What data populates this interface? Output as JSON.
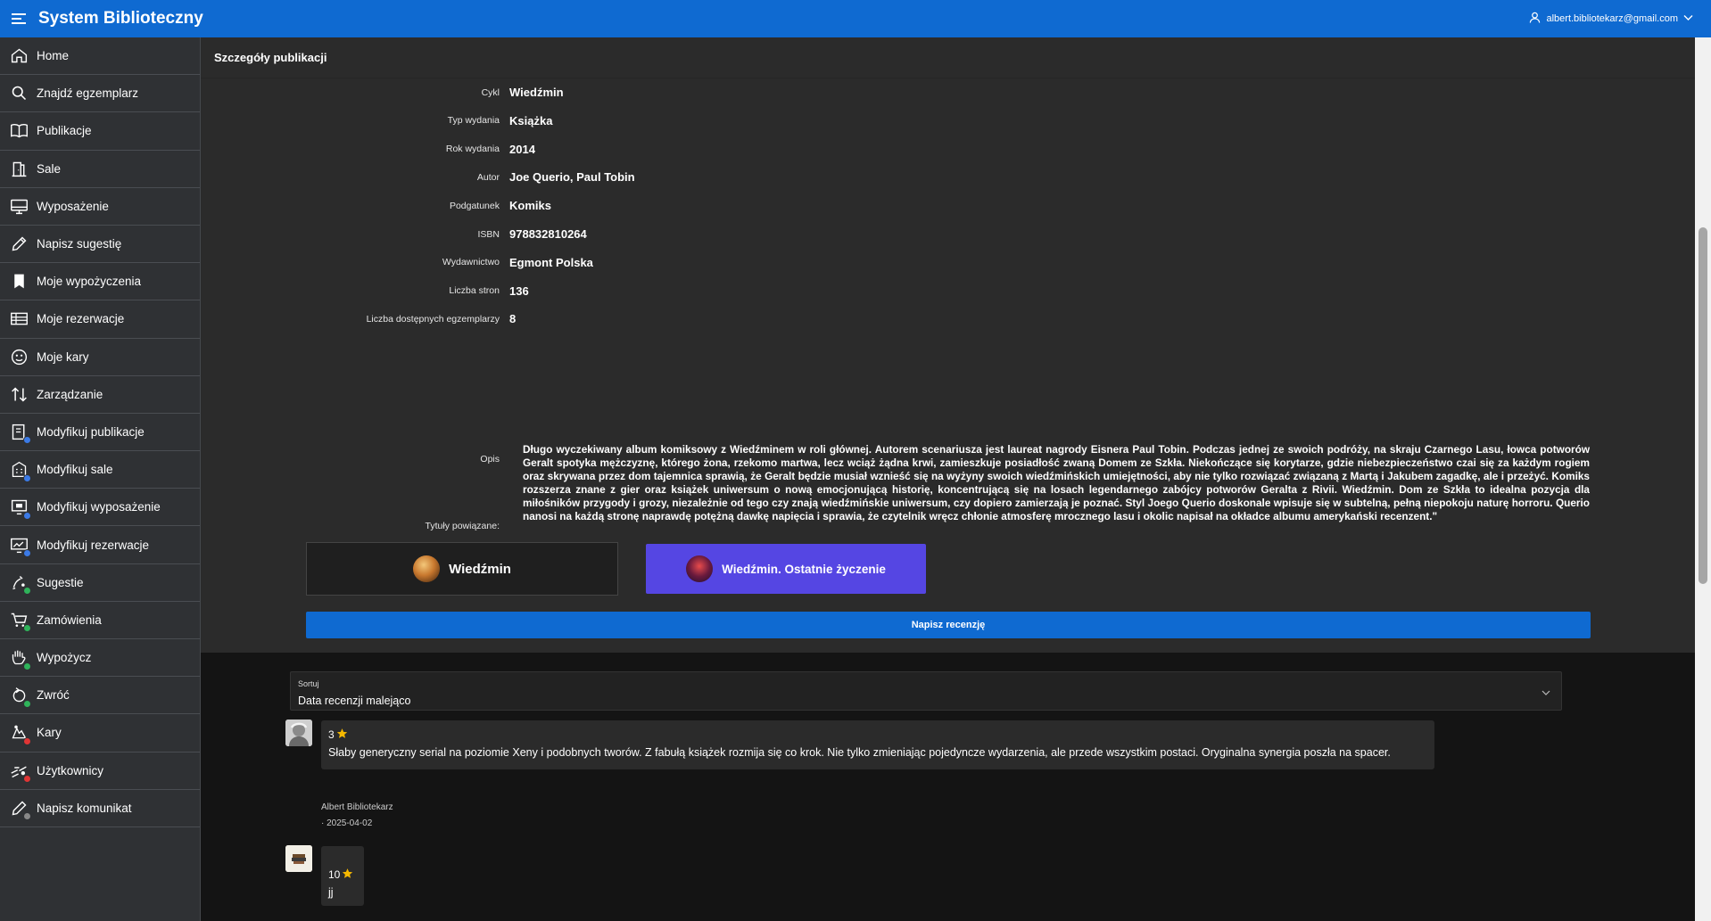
{
  "app": {
    "title": "System Biblioteczny",
    "user_email": "albert.bibliotekarz@gmail.com"
  },
  "sidebar": {
    "items": [
      {
        "label": "Home",
        "icon": "home-icon"
      },
      {
        "label": "Znajdź egzemplarz",
        "icon": "search-icon"
      },
      {
        "label": "Publikacje",
        "icon": "book-open-icon"
      },
      {
        "label": "Sale",
        "icon": "room-icon"
      },
      {
        "label": "Wyposażenie",
        "icon": "monitor-icon"
      },
      {
        "label": "Napisz sugestię",
        "icon": "pencil-icon"
      },
      {
        "label": "Moje wypożyczenia",
        "icon": "bookmark-icon"
      },
      {
        "label": "Moje rezerwacje",
        "icon": "table-icon"
      },
      {
        "label": "Moje kary",
        "icon": "fine-icon"
      },
      {
        "label": "Zarządzanie",
        "icon": "sort-arrows-icon"
      },
      {
        "label": "Modyfikuj publikacje",
        "icon": "edit-book-icon",
        "badge": "blue"
      },
      {
        "label": "Modyfikuj sale",
        "icon": "edit-building-icon",
        "badge": "blue"
      },
      {
        "label": "Modyfikuj wyposażenie",
        "icon": "edit-equipment-icon",
        "badge": "blue"
      },
      {
        "label": "Modyfikuj rezerwacje",
        "icon": "edit-reservation-icon",
        "badge": "blue"
      },
      {
        "label": "Sugestie",
        "icon": "suggestions-icon",
        "badge": "green"
      },
      {
        "label": "Zamówienia",
        "icon": "cart-icon",
        "badge": "green"
      },
      {
        "label": "Wypożycz",
        "icon": "hand-icon",
        "badge": "green"
      },
      {
        "label": "Zwróć",
        "icon": "return-icon",
        "badge": "green"
      },
      {
        "label": "Kary",
        "icon": "penalty-icon",
        "badge": "red"
      },
      {
        "label": "Użytkownicy",
        "icon": "users-icon",
        "badge": "red"
      },
      {
        "label": "Napisz komunikat",
        "icon": "message-icon",
        "badge": "gray"
      }
    ]
  },
  "details": {
    "header": "Szczegóły publikacji",
    "fields": [
      {
        "label": "Cykl",
        "value": "Wiedźmin"
      },
      {
        "label": "Typ wydania",
        "value": "Książka"
      },
      {
        "label": "Rok wydania",
        "value": "2014"
      },
      {
        "label": "Autor",
        "value": "Joe Querio, Paul Tobin"
      },
      {
        "label": "Podgatunek",
        "value": "Komiks"
      },
      {
        "label": "ISBN",
        "value": "978832810264"
      },
      {
        "label": "Wydawnictwo",
        "value": "Egmont Polska"
      },
      {
        "label": "Liczba stron",
        "value": "136"
      },
      {
        "label": "Liczba dostępnych egzemplarzy",
        "value": "8"
      }
    ],
    "description_label": "Opis",
    "description": "Długo wyczekiwany album komiksowy z Wiedźminem w roli głównej. Autorem scenariusza jest laureat nagrody Eisnera Paul Tobin. Podczas jednej ze swoich podróży, na skraju Czarnego Lasu, łowca potworów Geralt spotyka mężczyznę, którego żona, rzekomo martwa, lecz wciąż żądna krwi, zamieszkuje posiadłość zwaną Domem ze Szkła. Niekończące się korytarze, gdzie niebezpieczeństwo czai się za każdym rogiem oraz skrywana przez dom tajemnica sprawią, że Geralt będzie musiał wznieść się na wyżyny swoich wiedźmińskich umiejętności, aby nie tylko rozwiązać związaną z Martą i Jakubem zagadkę, ale i przeżyć. Komiks rozszerza znane z gier oraz książek uniwersum o nową emocjonującą historię, koncentrującą się na losach legendarnego zabójcy potworów Geralta z Rivii. Wiedźmin. Dom ze Szkła to idealna pozycja dla miłośników przygody i grozy, niezależnie od tego czy znają wiedźmińskie uniwersum, czy dopiero zamierzają je poznać. Styl Joego Querio doskonale wpisuje się w subtelną, pełną niepokoju naturę horroru. Querio nanosi na każdą stronę naprawdę potężną dawkę napięcia i sprawia, że czytelnik wręcz chłonie atmosferę mrocznego lasu i okolic napisał na okładce albumu amerykański recenzent.\"",
    "related_label": "Tytuły powiązane:",
    "related": [
      {
        "title": "Wiedźmin"
      },
      {
        "title": "Wiedźmin. Ostatnie życzenie"
      }
    ],
    "review_button": "Napisz recenzję"
  },
  "reviews": {
    "sort_label": "Sortuj",
    "sort_value": "Data recenzji malejąco",
    "items": [
      {
        "rating": "3",
        "text": "Słaby generyczny serial na poziomie Xeny i podobnych tworów. Z fabułą książek rozmija się co krok. Nie tylko zmieniając pojedyncze wydarzenia, ale przede wszystkim postaci. Oryginalna synergia poszła na spacer.",
        "author": "Albert Bibliotekarz",
        "date": "· 2025-04-02"
      },
      {
        "rating": "10",
        "text": "jj"
      }
    ]
  },
  "colors": {
    "accent": "#0f6ad1",
    "related_active": "#5546e3",
    "star": "#f5b800"
  }
}
